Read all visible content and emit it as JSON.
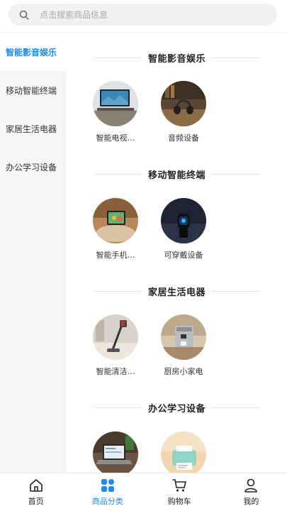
{
  "search": {
    "placeholder": "点击搜索商品信息",
    "icon": "search-icon"
  },
  "sidebar": {
    "active_index": 0,
    "items": [
      {
        "label": "智能影音娱乐"
      },
      {
        "label": "移动智能终端"
      },
      {
        "label": "家居生活电器"
      },
      {
        "label": "办公学习设备"
      }
    ]
  },
  "sections": [
    {
      "title": "智能影音娱乐",
      "items": [
        {
          "label": "智能电视…",
          "image": "smart-tv"
        },
        {
          "label": "音频设备",
          "image": "headphones"
        }
      ]
    },
    {
      "title": "移动智能终端",
      "items": [
        {
          "label": "智能手机…",
          "image": "tablet"
        },
        {
          "label": "可穿戴设备",
          "image": "smartwatch"
        }
      ]
    },
    {
      "title": "家居生活电器",
      "items": [
        {
          "label": "智能清洁…",
          "image": "vacuum"
        },
        {
          "label": "厨房小家电",
          "image": "coffee-machine"
        }
      ]
    },
    {
      "title": "办公学习设备",
      "items": [
        {
          "label": "",
          "image": "laptop"
        },
        {
          "label": "",
          "image": "printer"
        }
      ]
    }
  ],
  "tabbar": {
    "active_index": 1,
    "tabs": [
      {
        "label": "首页",
        "icon": "home-icon"
      },
      {
        "label": "商品分类",
        "icon": "category-icon"
      },
      {
        "label": "购物车",
        "icon": "cart-icon"
      },
      {
        "label": "我的",
        "icon": "user-icon"
      }
    ]
  },
  "colors": {
    "accent": "#1a8cf0",
    "sidebar_bg": "#f6f6f6",
    "search_bg": "#f1f1f3"
  }
}
